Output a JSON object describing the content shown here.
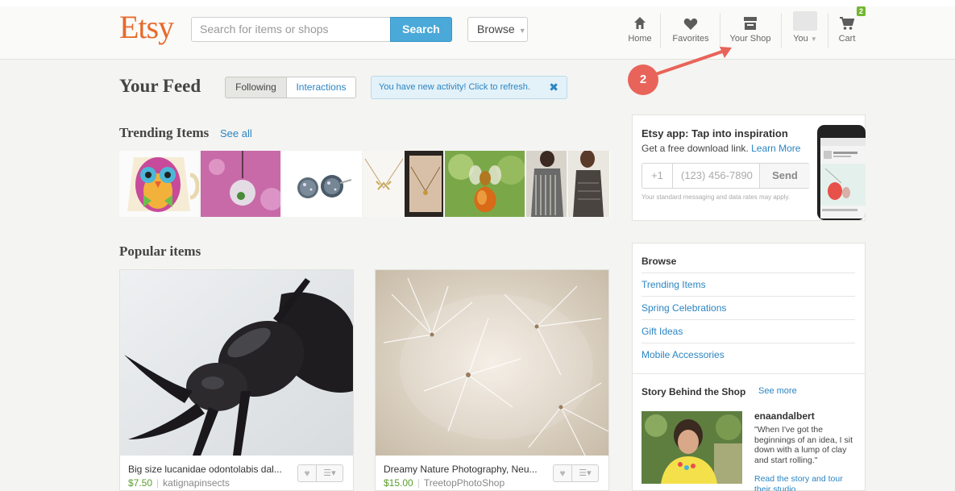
{
  "header": {
    "logo": "Etsy",
    "search_placeholder": "Search for items or shops",
    "search_button": "Search",
    "browse_label": "Browse",
    "nav": {
      "home": "Home",
      "favorites": "Favorites",
      "your_shop": "Your Shop",
      "you": "You",
      "cart": "Cart",
      "cart_count": "2"
    }
  },
  "annotation": {
    "step": "2"
  },
  "feed": {
    "title": "Your Feed",
    "tabs": {
      "following": "Following",
      "interactions": "Interactions"
    },
    "activity_notice": "You have new activity! Click to refresh.",
    "activity_close": "✖"
  },
  "trending": {
    "title": "Trending Items",
    "see_all": "See all"
  },
  "popular": {
    "title": "Popular items",
    "items": [
      {
        "name": "Big size lucanidae odontolabis dal...",
        "price": "$7.50",
        "shop": "katignapinsects"
      },
      {
        "name": "Dreamy Nature Photography, Neu...",
        "price": "$15.00",
        "shop": "TreetopPhotoShop"
      }
    ]
  },
  "app_promo": {
    "title": "Etsy app: Tap into inspiration",
    "subtitle": "Get a free download link.",
    "learn_more": "Learn More",
    "country_code": "+1",
    "phone_placeholder": "(123) 456-7890",
    "send": "Send",
    "note": "Your standard messaging and data rates may apply."
  },
  "browse": {
    "title": "Browse",
    "links": [
      "Trending Items",
      "Spring Celebrations",
      "Gift Ideas",
      "Mobile Accessories"
    ]
  },
  "story": {
    "title": "Story Behind the Shop",
    "see_more": "See more",
    "shop_name": "enaandalbert",
    "quote": "\"When I've got the beginnings of an idea, I sit down with a lump of clay and start rolling.\"",
    "link": "Read the story and tour their studio"
  },
  "colors": {
    "brand": "#e8692a",
    "link": "#2b85c2",
    "search": "#4aa9d9",
    "price": "#5a9e2d",
    "annotation": "#e8645a"
  }
}
